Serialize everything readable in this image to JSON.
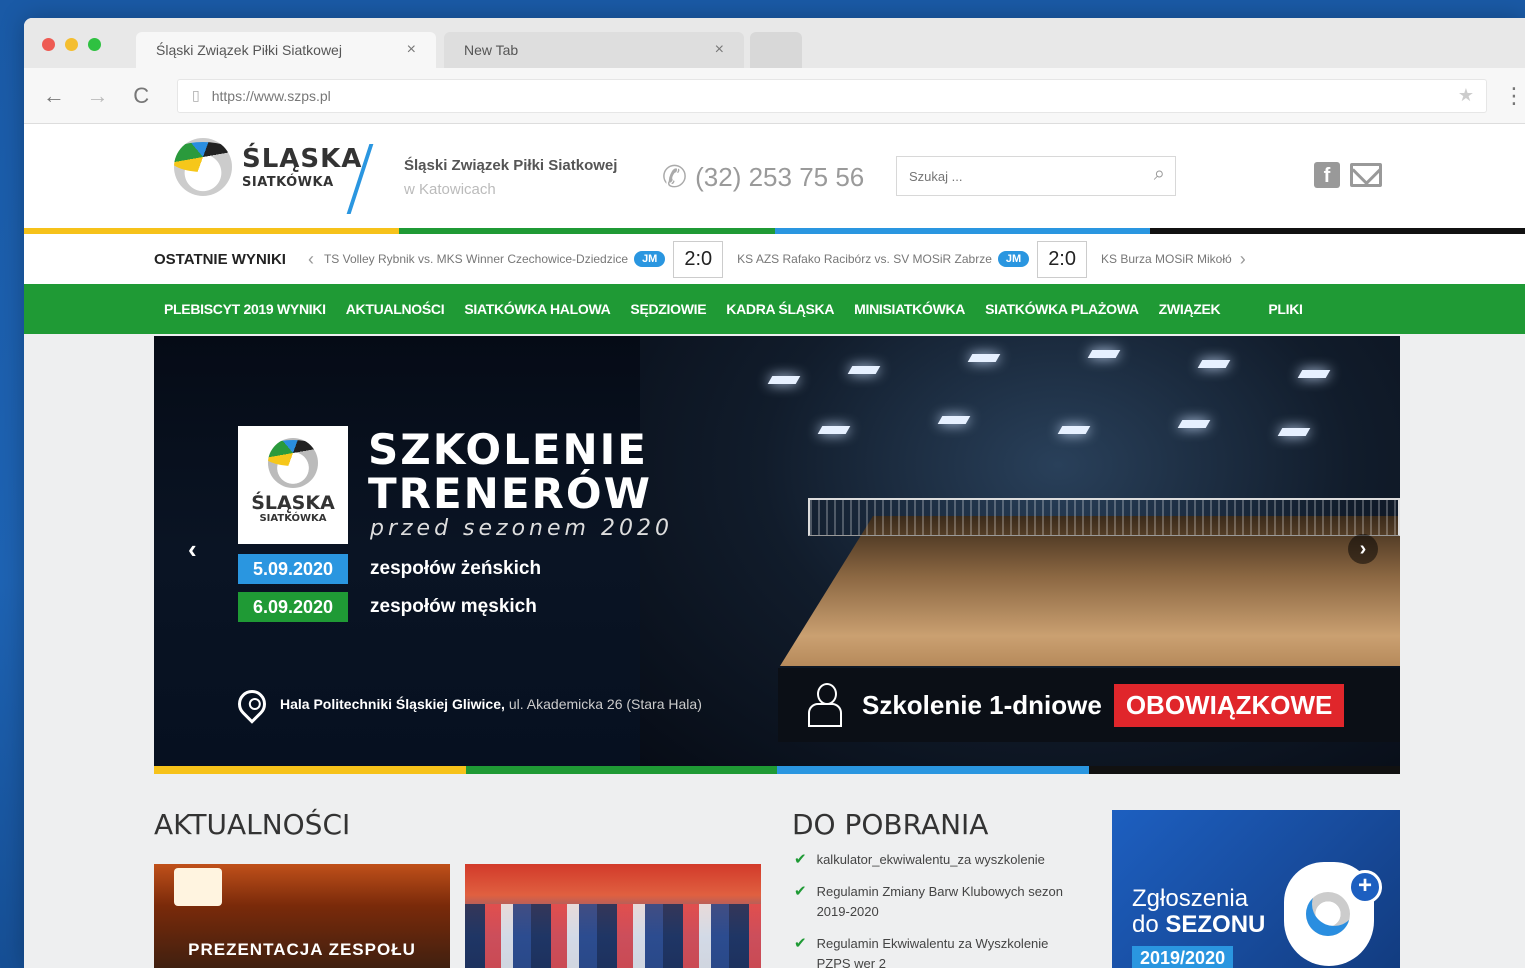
{
  "browser": {
    "tabs": [
      {
        "label": "Śląski Związek Piłki Siatkowej",
        "close": "×"
      },
      {
        "label": "New Tab",
        "close": "×"
      }
    ],
    "url": "https://www.szps.pl",
    "back": "←",
    "forward": "→",
    "reload": "C",
    "star": "★",
    "menu": "⋮"
  },
  "header": {
    "logo_big": "ŚLĄSKA",
    "logo_small": "SIATKÓWKA",
    "assoc_line1": "Śląski Związek Piłki Siatkowej",
    "assoc_line2": "w Katowicach",
    "phone": "(32) 253 75 56",
    "search_placeholder": "Szukaj ..."
  },
  "results": {
    "label": "OSTATNIE WYNIKI",
    "matches": [
      {
        "teams": "TS Volley Rybnik vs. MKS Winner Czechowice-Dziedzice",
        "badge": "JM",
        "score": "2:0"
      },
      {
        "teams": "KS AZS Rafako Racibórz vs. SV MOSiR Zabrze",
        "badge": "JM",
        "score": "2:0"
      },
      {
        "teams": "KS Burza MOSiR Mikołó",
        "badge": "",
        "score": ""
      }
    ]
  },
  "nav": {
    "items": [
      "PLEBISCYT 2019 WYNIKI",
      "AKTUALNOŚCI",
      "SIATKÓWKA HALOWA",
      "SĘDZIOWIE",
      "KADRA ŚLĄSKA",
      "MINISIATKÓWKA",
      "SIATKÓWKA PLAŻOWA",
      "ZWIĄZEK",
      "PLIKI"
    ]
  },
  "banner": {
    "logo_big": "ŚLĄSKA",
    "logo_small": "SIATKÓWKA",
    "title_line1": "SZKOLENIE",
    "title_line2": "TRENERÓW",
    "subtitle": "przed sezonem 2020",
    "date1": "5.09.2020",
    "date1_text": "zespołów żeńskich",
    "date2": "6.09.2020",
    "date2_text": "zespołów męskich",
    "venue_bold": "Hala Politechniki Śląskiej Gliwice,",
    "venue_rest": "ul. Akademicka 26 (Stara Hala)",
    "mandatory_label": "Szkolenie 1-dniowe",
    "mandatory_tag": "OBOWIĄZKOWE",
    "prev": "‹",
    "next": "›"
  },
  "news": {
    "title": "AKTUALNOŚCI",
    "cards": [
      {
        "caption": "PREZENTACJA ZESPOŁU"
      },
      {
        "caption": ""
      }
    ]
  },
  "downloads": {
    "title": "DO POBRANIA",
    "items": [
      "kalkulator_ekwiwalentu_za wyszkolenie",
      "Regulamin Zmiany Barw Klubowych sezon 2019-2020",
      "Regulamin Ekwiwalentu za Wyszkolenie PZPS wer 2"
    ]
  },
  "promo": {
    "line1": "Zgłoszenia",
    "line2_pre": "do ",
    "line2_bold": "SEZONU",
    "season": "2019/2020",
    "plus": "+"
  },
  "colors": {
    "green": "#1f9a35",
    "blue": "#2a96e0",
    "yellow": "#f6c21a",
    "red": "#e0262b"
  }
}
